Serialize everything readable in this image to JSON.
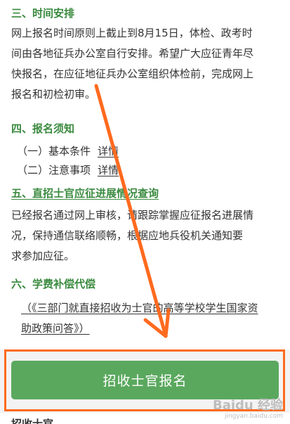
{
  "section3": {
    "heading": "三、时间安排",
    "lines": [
      "网上报名时间原则上截止到8月15日，体检、政考时",
      "间由各地征兵办公室自行安排。希望广大应征青年尽",
      "快报名，在应征地征兵办公室组织体检前，完成网上",
      "报名和初检初审。"
    ]
  },
  "section4": {
    "heading": "四、报名须知",
    "items": [
      {
        "label": "（一）基本条件",
        "link": "详情"
      },
      {
        "label": "（二）注意事项",
        "link": "详情"
      }
    ]
  },
  "section5": {
    "heading": "五、直招士官应征进展情况查询",
    "lines": [
      "已经报名通过网上审核，请跟踪掌握应征报名进展情",
      "况，保持通信联络顺畅，根据应地兵役机关通知要",
      "求参加应征。"
    ]
  },
  "section6": {
    "heading": "六、学费补偿代偿",
    "policy_lines": [
      "（《三部门就直接招收为士官的高等学校学生国家资",
      "助政策问答》）"
    ]
  },
  "enroll_button": {
    "label": "招收士官报名"
  },
  "next_heading": "招收士官",
  "watermark": {
    "logo": "Baidu 经验",
    "url": "jingyan.baidu.com"
  },
  "colors": {
    "heading_green": "#3a8a3f",
    "button_green": "#5aa85e",
    "annotation_orange": "#ff6a1f"
  }
}
